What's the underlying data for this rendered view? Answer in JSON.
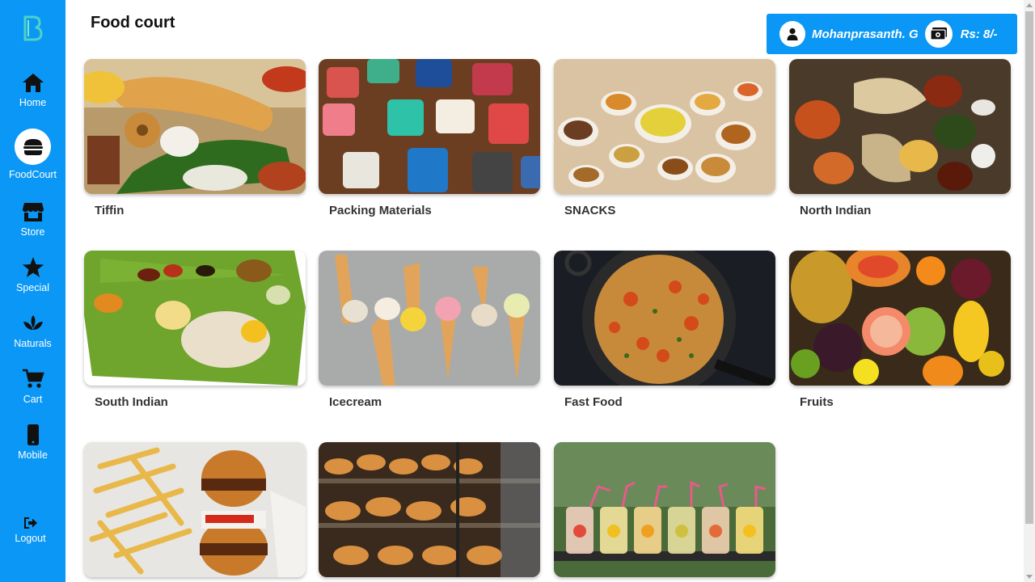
{
  "sidebar": {
    "logo_icon": "brand-logo-icon",
    "items": [
      {
        "label": "Home",
        "icon": "home-icon"
      },
      {
        "label": "FoodCourt",
        "icon": "burger-icon",
        "active": true
      },
      {
        "label": "Store",
        "icon": "store-icon"
      },
      {
        "label": "Special",
        "icon": "star-icon"
      },
      {
        "label": "Naturals",
        "icon": "leaf-icon"
      },
      {
        "label": "Cart",
        "icon": "cart-icon"
      },
      {
        "label": "Mobile",
        "icon": "mobile-icon"
      },
      {
        "label": "Logout",
        "icon": "logout-icon"
      }
    ]
  },
  "header": {
    "title": "Food court",
    "user_name": "Mohanprasanth. G",
    "balance": "Rs: 8/-",
    "user_icon": "user-icon",
    "wallet_icon": "money-icon"
  },
  "categories": [
    {
      "label": "Tiffin"
    },
    {
      "label": "Packing Materials"
    },
    {
      "label": "SNACKS"
    },
    {
      "label": "North Indian"
    },
    {
      "label": "South Indian"
    },
    {
      "label": "Icecream"
    },
    {
      "label": "Fast Food"
    },
    {
      "label": "Fruits"
    },
    {
      "label": ""
    },
    {
      "label": ""
    },
    {
      "label": ""
    }
  ],
  "colors": {
    "accent": "#0a97f5",
    "text": "#333333"
  }
}
